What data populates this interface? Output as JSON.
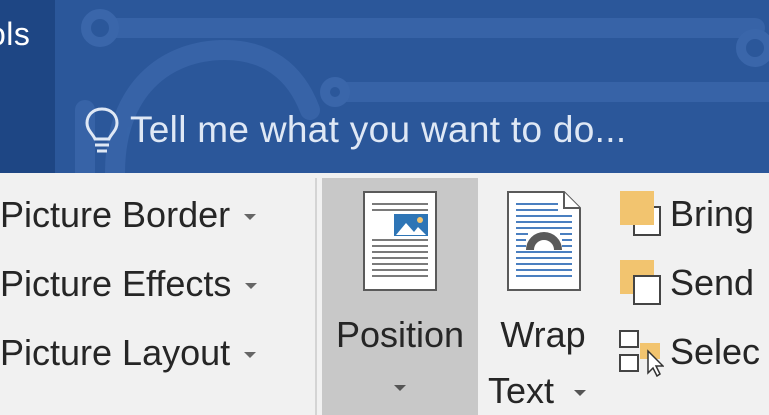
{
  "titlebar": {
    "tab_label": "ols",
    "tell_me": "Tell me what you want to do..."
  },
  "ribbon": {
    "picture_styles": [
      {
        "label": "Picture Border",
        "icon": "caret-down-icon"
      },
      {
        "label": "Picture Effects",
        "icon": "caret-down-icon"
      },
      {
        "label": "Picture Layout",
        "icon": "caret-down-icon"
      }
    ],
    "position": {
      "label": "Position",
      "icon": "position-icon"
    },
    "wrap_text": {
      "label_line1": "Wrap",
      "label_line2": "Text",
      "icon": "wrap-text-icon"
    },
    "arrange": [
      {
        "label": "Bring",
        "icon": "bring-forward-icon"
      },
      {
        "label": "Send",
        "icon": "send-backward-icon"
      },
      {
        "label": "Selec",
        "icon": "selection-pane-icon"
      }
    ]
  },
  "colors": {
    "ribbon_blue": "#2b579a",
    "tab_dark_blue": "#1e4684",
    "ribbon_bg": "#f1f1f1",
    "active_button": "#c8c8c8",
    "arrange_accent": "#f2c46f"
  }
}
